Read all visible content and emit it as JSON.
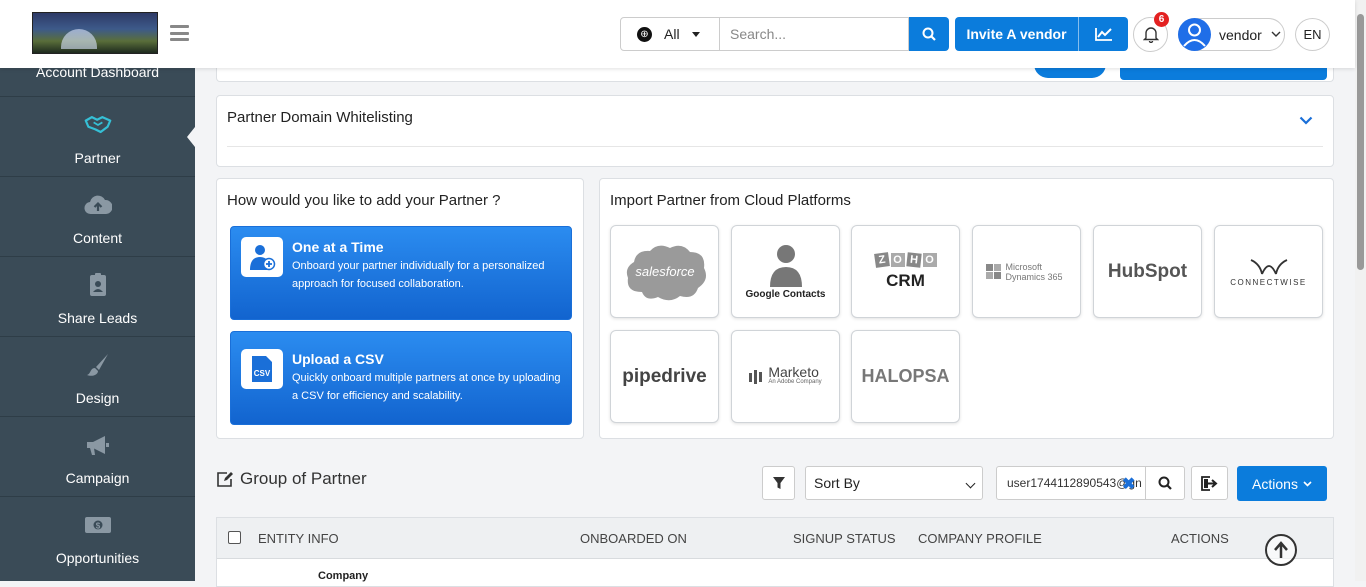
{
  "header": {
    "scope": "All",
    "search_placeholder": "Search...",
    "invite_label": "Invite A vendor",
    "notification_count": "6",
    "username": "vendor",
    "language": "EN"
  },
  "sidebar": {
    "items": [
      {
        "label": "Account Dashboard",
        "icon": "dashboard-icon"
      },
      {
        "label": "Partner",
        "icon": "handshake-icon"
      },
      {
        "label": "Content",
        "icon": "cloud-upload-icon"
      },
      {
        "label": "Share Leads",
        "icon": "id-badge-icon"
      },
      {
        "label": "Design",
        "icon": "paintbrush-icon"
      },
      {
        "label": "Campaign",
        "icon": "megaphone-icon"
      },
      {
        "label": "Opportunities",
        "icon": "money-icon"
      }
    ],
    "active": "Partner",
    "active_color": "#35c0d6"
  },
  "domain_section": {
    "title": "Partner Domain Whitelisting"
  },
  "add_partner": {
    "title": "How would you like to add your Partner ?",
    "options": [
      {
        "title": "One at a Time",
        "description": "Onboard your partner individually for a personalized approach for focused collaboration."
      },
      {
        "title": "Upload a CSV",
        "description": "Quickly onboard multiple partners at once by uploading a CSV for efficiency and scalability.",
        "icon_text": "CSV"
      }
    ]
  },
  "import": {
    "title": "Import Partner from Cloud Platforms",
    "platforms": [
      {
        "name": "salesforce"
      },
      {
        "name": "Google Contacts"
      },
      {
        "name": "CRM",
        "brand": "ZOHO"
      },
      {
        "name": "Microsoft Dynamics 365"
      },
      {
        "name": "HubSpot"
      },
      {
        "name": "CONNECTWISE"
      },
      {
        "name": "pipedrive"
      },
      {
        "name": "Marketo",
        "sub": "An Adobe Company"
      },
      {
        "name": "HALOPSA"
      }
    ]
  },
  "group": {
    "title": "Group of Partner",
    "sort_label": "Sort By",
    "filter_value": "user1744112890543@gn",
    "actions_label": "Actions"
  },
  "table": {
    "columns": [
      "ENTITY INFO",
      "ONBOARDED ON",
      "SIGNUP STATUS",
      "COMPANY PROFILE",
      "ACTIONS"
    ],
    "first_row_text": "Company"
  },
  "colors": {
    "primary": "#0b7cdc",
    "sidebar_bg": "#3a4b57",
    "badge": "#e32121"
  }
}
